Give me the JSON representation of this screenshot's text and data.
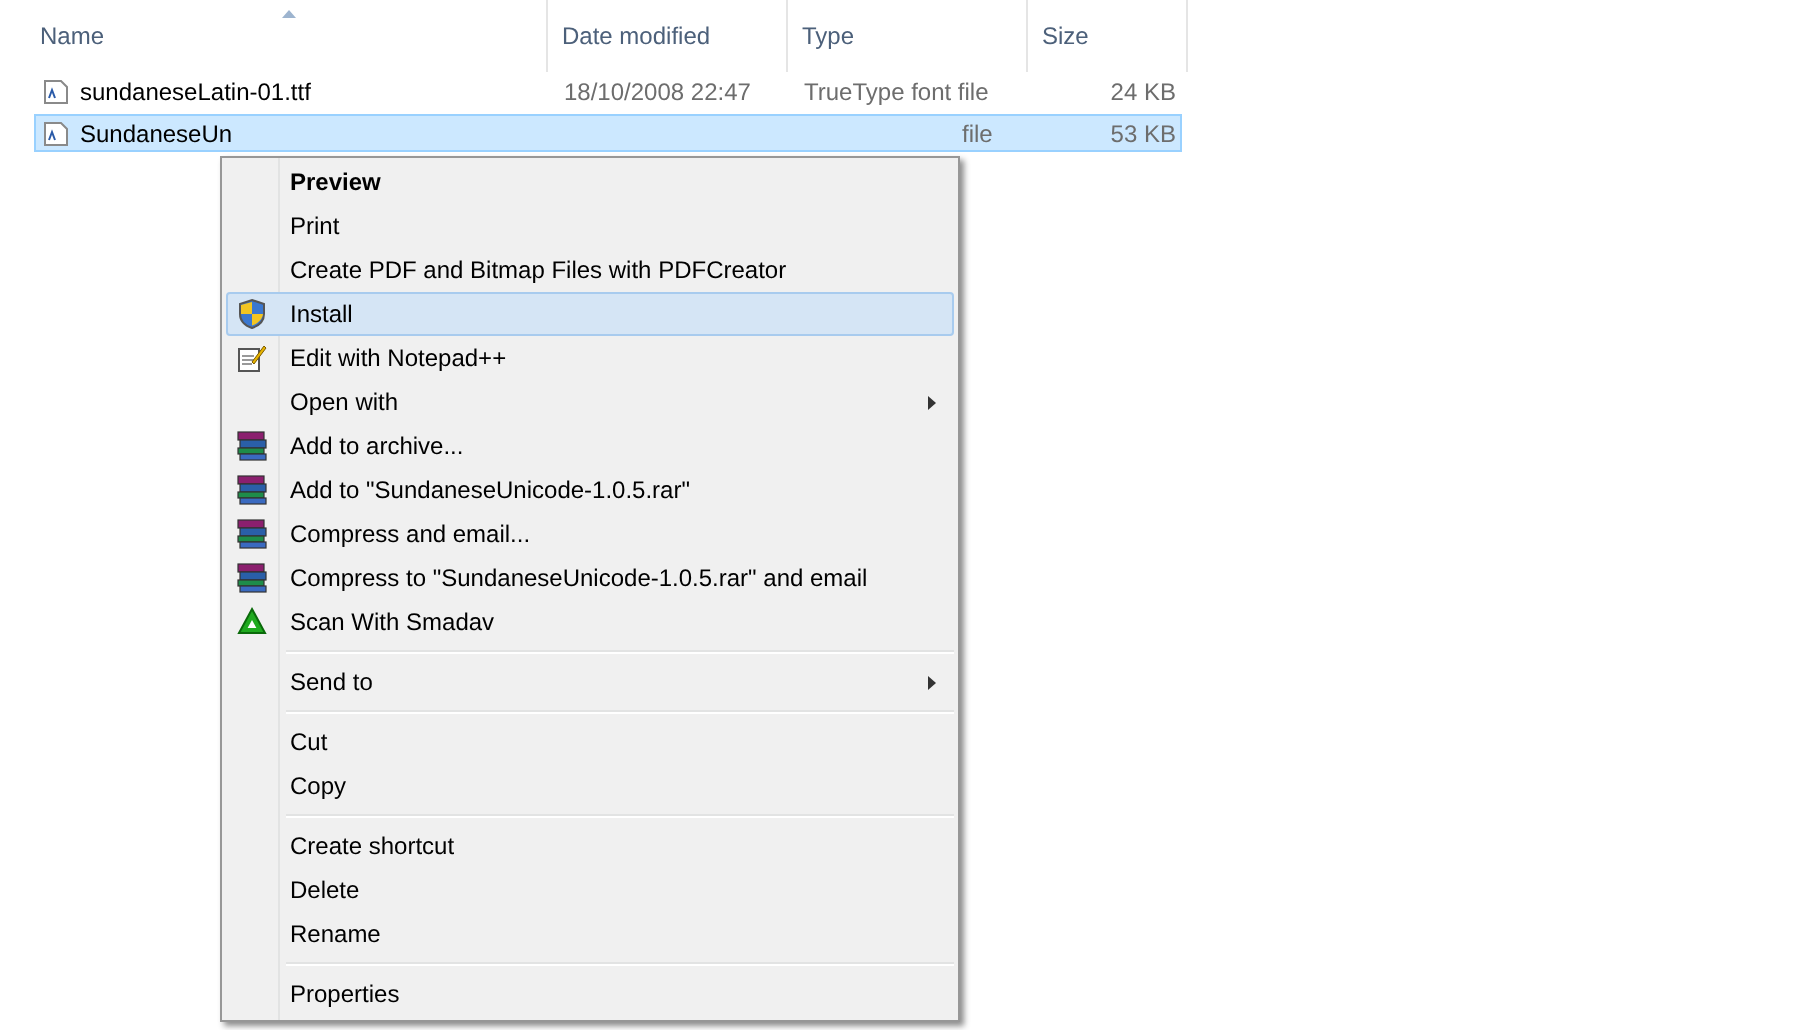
{
  "columns": [
    {
      "label": "Name",
      "sorted": true
    },
    {
      "label": "Date modified",
      "sorted": false
    },
    {
      "label": "Type",
      "sorted": false
    },
    {
      "label": "Size",
      "sorted": false
    }
  ],
  "files": [
    {
      "name": "sundaneseLatin-01.ttf",
      "date": "18/10/2008 22:47",
      "type": "TrueType font file",
      "size": "24 KB",
      "selected": false
    },
    {
      "name": "SundaneseUn",
      "type": "file",
      "size": "53 KB",
      "selected": true
    }
  ],
  "context_menu": {
    "sections": [
      [
        {
          "label": "Preview",
          "kind": "none",
          "bold": true,
          "submenu": false,
          "selected": false
        },
        {
          "label": "Print",
          "kind": "none",
          "bold": false,
          "submenu": false,
          "selected": false
        },
        {
          "label": "Create PDF and Bitmap Files with PDFCreator",
          "kind": "none",
          "bold": false,
          "submenu": false,
          "selected": false
        },
        {
          "label": "Install",
          "kind": "shield",
          "bold": false,
          "submenu": false,
          "selected": true
        },
        {
          "label": "Edit with Notepad++",
          "kind": "notepad",
          "bold": false,
          "submenu": false,
          "selected": false
        },
        {
          "label": "Open with",
          "kind": "none",
          "bold": false,
          "submenu": true,
          "selected": false
        },
        {
          "label": "Add to archive...",
          "kind": "books",
          "bold": false,
          "submenu": false,
          "selected": false
        },
        {
          "label": "Add to \"SundaneseUnicode-1.0.5.rar\"",
          "kind": "books",
          "bold": false,
          "submenu": false,
          "selected": false
        },
        {
          "label": "Compress and email...",
          "kind": "books",
          "bold": false,
          "submenu": false,
          "selected": false
        },
        {
          "label": "Compress to \"SundaneseUnicode-1.0.5.rar\" and email",
          "kind": "books",
          "bold": false,
          "submenu": false,
          "selected": false
        },
        {
          "label": "Scan With Smadav",
          "kind": "triangle",
          "bold": false,
          "submenu": false,
          "selected": false
        }
      ],
      [
        {
          "label": "Send to",
          "kind": "none",
          "bold": false,
          "submenu": true,
          "selected": false
        }
      ],
      [
        {
          "label": "Cut",
          "kind": "none",
          "bold": false,
          "submenu": false,
          "selected": false
        },
        {
          "label": "Copy",
          "kind": "none",
          "bold": false,
          "submenu": false,
          "selected": false
        }
      ],
      [
        {
          "label": "Create shortcut",
          "kind": "none",
          "bold": false,
          "submenu": false,
          "selected": false
        },
        {
          "label": "Delete",
          "kind": "none",
          "bold": false,
          "submenu": false,
          "selected": false
        },
        {
          "label": "Rename",
          "kind": "none",
          "bold": false,
          "submenu": false,
          "selected": false
        }
      ],
      [
        {
          "label": "Properties",
          "kind": "none",
          "bold": false,
          "submenu": false,
          "selected": false
        }
      ]
    ]
  }
}
